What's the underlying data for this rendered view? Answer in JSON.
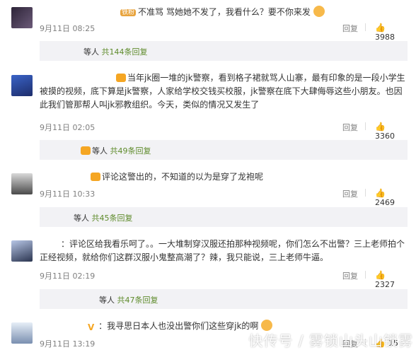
{
  "comments": [
    {
      "badge": "铁粉",
      "text": "不准骂 骂她她不发了，我看什么？要不你来发",
      "date": "9月11日 08:25",
      "reply_label": "回复",
      "likes": "3988",
      "reply_summary": {
        "who": "等人",
        "count": "共144条回复"
      }
    },
    {
      "badge": "",
      "text": "当年jk圈一堆的jk警察，看到格子裙就骂人山寨，最有印象的是一段小学生被摸的视频，底下算是jk警察，人家给学校交钱买校服，jk警察在底下大肆侮辱这些小朋友。也因此我们管那帮人叫jk邪教组织。今天，类似的情况又发生了",
      "date": "9月11日 02:05",
      "reply_label": "回复",
      "likes": "3360",
      "reply_summary": {
        "who": "等人",
        "count": "共49条回复"
      }
    },
    {
      "badge": "",
      "text": "评论这警出的，不知道的以为是穿了龙袍呢",
      "date": "9月11日 10:33",
      "reply_label": "回复",
      "likes": "2469",
      "reply_summary": {
        "who": "等人",
        "count": "共45条回复"
      }
    },
    {
      "badge": "",
      "text": "：评论区给我看乐呵了。。一大堆制穿汉服还拍那种视频呢，你们怎么不出警？三上老师拍个正经视频，就给你们这群汉服小鬼整高潮了？辣，我只能说，三上老师牛逼。",
      "date": "9月11日 02:19",
      "reply_label": "回复",
      "likes": "2327",
      "reply_summary": {
        "who": "等人",
        "count": "共47条回复"
      }
    },
    {
      "badge": "V",
      "text": "：我寻思日本人也没出警你们这些穿jk的啊",
      "date": "9月11日 13:19",
      "reply_label": "回复",
      "likes": "15",
      "reply_summary": null
    }
  ],
  "watermark": "快传号 / 雾锁山头山锁雾",
  "colors": {
    "link": "#5e8b2b",
    "meta": "#808080",
    "replybar_bg": "#f2f2f5"
  }
}
